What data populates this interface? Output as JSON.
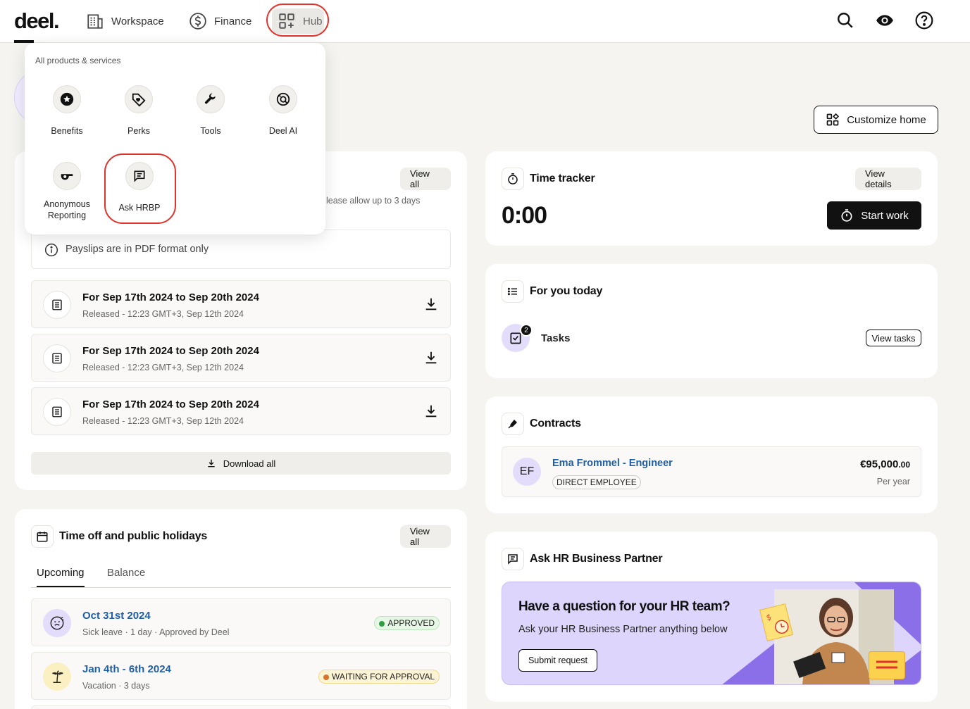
{
  "nav": {
    "logo": "deel.",
    "items": [
      {
        "label": "Workspace"
      },
      {
        "label": "Finance"
      },
      {
        "label": "Hub"
      }
    ]
  },
  "customize": {
    "label": "Customize home"
  },
  "dropdown": {
    "heading": "All products & services",
    "items": [
      {
        "label": "Benefits"
      },
      {
        "label": "Perks"
      },
      {
        "label": "Tools"
      },
      {
        "label": "Deel AI"
      },
      {
        "label": "Anonymous Reporting"
      },
      {
        "label": "Ask HRBP"
      }
    ]
  },
  "payslips": {
    "view_all": "View all",
    "note_partial": "lease allow up to 3 days",
    "info": "Payslips are in PDF format only",
    "rows": [
      {
        "title": "For Sep 17th 2024 to Sep 20th 2024",
        "sub": "Released - 12:23 GMT+3, Sep 12th 2024"
      },
      {
        "title": "For Sep 17th 2024 to Sep 20th 2024",
        "sub": "Released - 12:23 GMT+3, Sep 12th 2024"
      },
      {
        "title": "For Sep 17th 2024 to Sep 20th 2024",
        "sub": "Released - 12:23 GMT+3, Sep 12th 2024"
      }
    ],
    "download_all": "Download all"
  },
  "timeoff": {
    "title": "Time off and public holidays",
    "view_all": "View all",
    "tabs": [
      {
        "label": "Upcoming"
      },
      {
        "label": "Balance"
      }
    ],
    "rows": [
      {
        "date": "Oct 31st 2024",
        "sub": "Sick leave · 1 day · Approved by Deel",
        "status": "APPROVED"
      },
      {
        "date": "Jan 4th - 6th 2024",
        "sub": "Vacation · 3 days",
        "status": "WAITING FOR APPROVAL"
      }
    ]
  },
  "timetracker": {
    "title": "Time tracker",
    "view_details": "View details",
    "time": "0:00",
    "start": "Start work"
  },
  "foryou": {
    "title": "For you today",
    "tasks_label": "Tasks",
    "tasks_count": "2",
    "view_tasks": "View tasks"
  },
  "contracts": {
    "title": "Contracts",
    "initials": "EF",
    "name": "Ema Frommel - Engineer",
    "type": "DIRECT EMPLOYEE",
    "amount_main": "€95,000",
    "amount_cents": ".00",
    "period": "Per year"
  },
  "hrbp": {
    "title": "Ask HR Business Partner",
    "banner_title": "Have a question for your HR team?",
    "banner_sub": "Ask your HR Business Partner anything below",
    "submit": "Submit request"
  },
  "colors": {
    "accent_red": "#e0332a",
    "link_blue": "#1f5fa8",
    "lavender": "#ddd5fb",
    "approved_green": "#2f9e44",
    "waiting_orange": "#d9742b"
  }
}
